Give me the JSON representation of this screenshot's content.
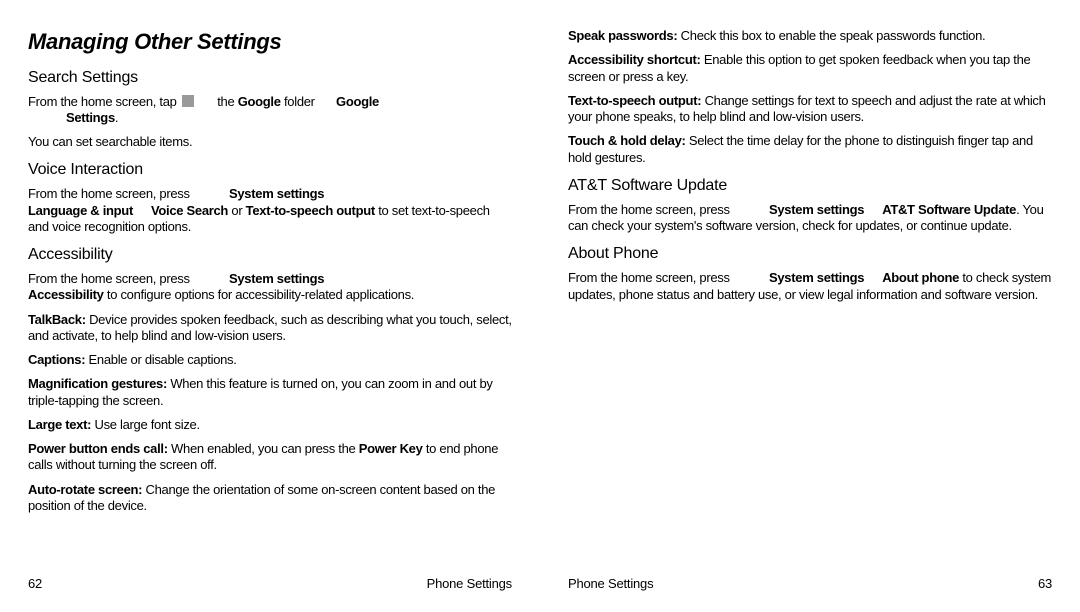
{
  "title": "Managing Other Settings",
  "left": {
    "search": {
      "heading": "Search Settings",
      "line1a": "From the home screen, tap ",
      "line1b": " the ",
      "bold_google_folder": "Google",
      "line1c": " folder ",
      "bold_google": "Google",
      "bold_settings": "Settings",
      "dot": ".",
      "line2": "You can set searchable items."
    },
    "voice": {
      "heading": "Voice Interaction",
      "p1a": "From the home screen, press ",
      "p1b": "System settings",
      "p2a": "Language & input",
      "p2b": "Voice Search",
      "p2c": " or ",
      "p2d": "Text-to-speech output",
      "p2e": " to set text-to-speech and voice recognition options."
    },
    "acc": {
      "heading": "Accessibility",
      "p1a": "From the home screen, press ",
      "p1b": "System settings",
      "p2a": "Accessibility",
      "p2b": " to configure options for accessibility-related applications.",
      "tb1": "TalkBack:",
      "tb2": " Device provides spoken feedback, such as describing what you touch, select, and activate, to help blind and low-vision users.",
      "cap1": "Captions:",
      "cap2": " Enable or disable captions.",
      "mg1": "Magnification gestures:",
      "mg2": " When this feature is turned on, you can zoom in and out by triple-tapping the screen.",
      "lt1": "Large text:",
      "lt2": " Use large font size.",
      "pb1": "Power button ends call:",
      "pb2": " When enabled, you can press the ",
      "pb3": "Power Key",
      "pb4": " to end phone calls without turning the screen off.",
      "ar1": "Auto-rotate screen:",
      "ar2": " Change the orientation of some on-screen content based on the position of the device."
    },
    "footer": {
      "left": "62",
      "right": "Phone Settings"
    }
  },
  "right": {
    "acc2": {
      "sp1": "Speak passwords:",
      "sp2": " Check this box to enable the speak passwords function.",
      "as1": "Accessibility shortcut:",
      "as2": " Enable this option to get spoken feedback when you tap the screen or press a key.",
      "tts1": "Text-to-speech output:",
      "tts2": " Change settings for text to speech and adjust the rate at which your phone speaks, to help blind and low-vision users.",
      "th1": "Touch & hold delay:",
      "th2": " Select the time delay for the phone to distinguish finger tap and hold gestures."
    },
    "att": {
      "heading": "AT&T Software Update",
      "p1a": "From the home screen, press ",
      "p1b": "System settings",
      "p1c": "AT&T Software Update",
      "p1d": ". You can check your system's software version, check for updates, or continue update."
    },
    "about": {
      "heading": "About Phone",
      "p1a": "From the home screen, press ",
      "p1b": "System settings",
      "p1c": "About phone",
      "p1d": " to check system updates, phone status and battery use, or view legal information and software version."
    },
    "footer": {
      "left": "Phone Settings",
      "right": "63"
    }
  }
}
